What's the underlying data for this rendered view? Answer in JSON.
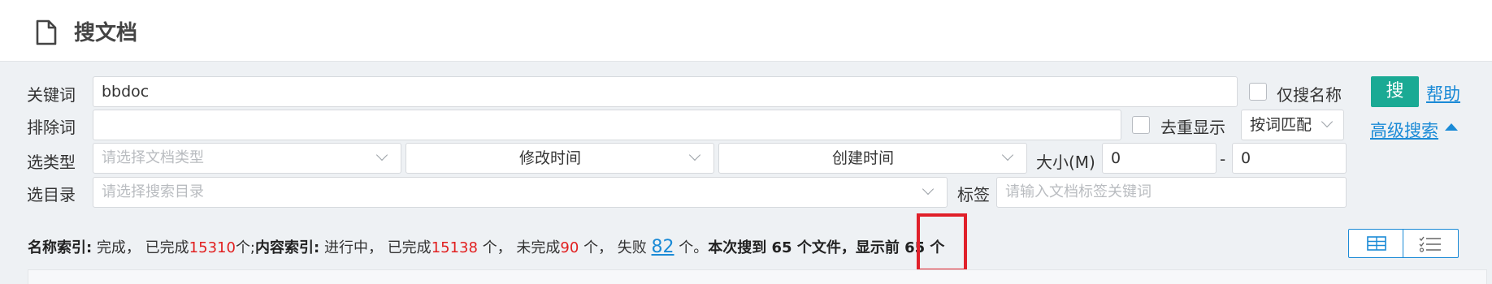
{
  "header": {
    "title": "搜文档",
    "icon": "document-icon"
  },
  "form": {
    "keyword": {
      "label": "关键词",
      "value": "bbdoc"
    },
    "name_only": {
      "label": "仅搜名称",
      "checked": false
    },
    "exclude": {
      "label": "排除词",
      "value": ""
    },
    "dedupe": {
      "label": "去重显示",
      "checked": false
    },
    "match_mode": {
      "value": "按词匹配"
    },
    "type": {
      "label": "选类型",
      "placeholder": "请选择文档类型"
    },
    "modified": {
      "value": "修改时间"
    },
    "created": {
      "value": "创建时间"
    },
    "size": {
      "label": "大小(M)",
      "min": "0",
      "sep": "-",
      "max": "0"
    },
    "dir": {
      "label": "选目录",
      "placeholder": "请选择搜索目录"
    },
    "tag": {
      "label": "标签",
      "placeholder": "请输入文档标签关键词"
    }
  },
  "actions": {
    "search_label": "搜",
    "help_label": "帮助",
    "advanced_label": "高级搜索"
  },
  "status": {
    "name_index_label": "名称索引:",
    "name_state": "完成，",
    "done_prefix": "已完成",
    "name_done": "15310",
    "unit_semicolon": "个;",
    "content_index_label": "内容索引:",
    "content_state": "进行中，",
    "content_done": "15138",
    "unit_comma": "个，",
    "undone_prefix": "未完成",
    "content_undone": "90",
    "failed_prefix": "失败",
    "content_failed": "82",
    "unit_period": "个。",
    "summary": "本次搜到 65 个文件，显示前 65 个"
  },
  "colors": {
    "accent": "#1aaa94",
    "link": "#1a8ad6",
    "alert": "#e11f1f"
  }
}
